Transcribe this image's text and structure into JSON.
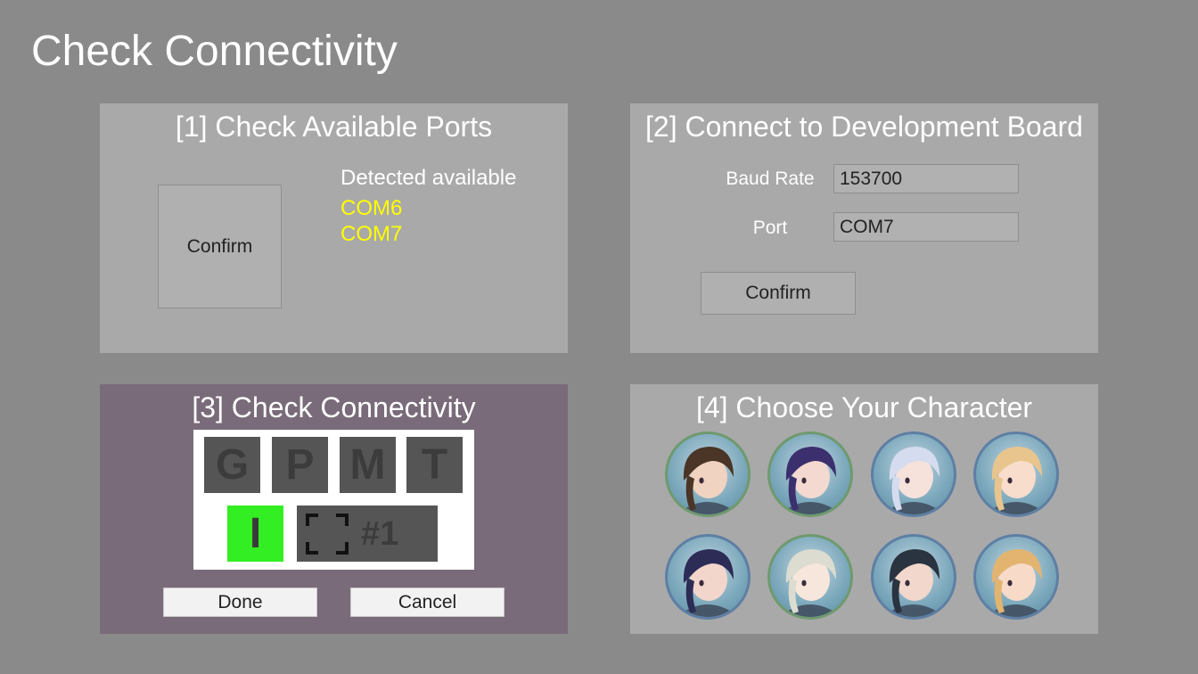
{
  "page": {
    "title": "Check Connectivity"
  },
  "panel1": {
    "heading": "[1] Check Available Ports",
    "confirm_label": "Confirm",
    "detected_label": "Detected available",
    "ports": [
      "COM6",
      "COM7"
    ]
  },
  "panel2": {
    "heading": "[2] Connect to Development Board",
    "baud_rate_label": "Baud Rate",
    "baud_rate_value": "153700",
    "port_label": "Port",
    "port_value": "COM7",
    "confirm_label": "Confirm"
  },
  "panel3": {
    "heading": "[3] Check Connectivity",
    "tiles": [
      "G",
      "P",
      "M",
      "T"
    ],
    "active_tile": "I",
    "scan_number": "#1",
    "done_label": "Done",
    "cancel_label": "Cancel",
    "colors": {
      "panel_bg": "#796b79",
      "active_tile": "#33ee22"
    }
  },
  "panel4": {
    "heading": "[4] Choose Your Character",
    "characters": [
      {
        "hair": "#4a3526",
        "skin": "#f0d3c0",
        "ring": "#6e9a6e"
      },
      {
        "hair": "#3b2f6e",
        "skin": "#f3d9d0",
        "ring": "#6e9a6e"
      },
      {
        "hair": "#d6dcef",
        "skin": "#f6e1db",
        "ring": "#5e7fa4"
      },
      {
        "hair": "#e8c58d",
        "skin": "#f8dccc",
        "ring": "#5e7fa4"
      },
      {
        "hair": "#2c2c56",
        "skin": "#f2d6cc",
        "ring": "#5e7fa4"
      },
      {
        "hair": "#dcdcd0",
        "skin": "#f6e6dc",
        "ring": "#6e9a6e"
      },
      {
        "hair": "#2a3340",
        "skin": "#f1d7cc",
        "ring": "#5e7fa4"
      },
      {
        "hair": "#e3b46f",
        "skin": "#f7dac8",
        "ring": "#5e7fa4"
      }
    ]
  }
}
